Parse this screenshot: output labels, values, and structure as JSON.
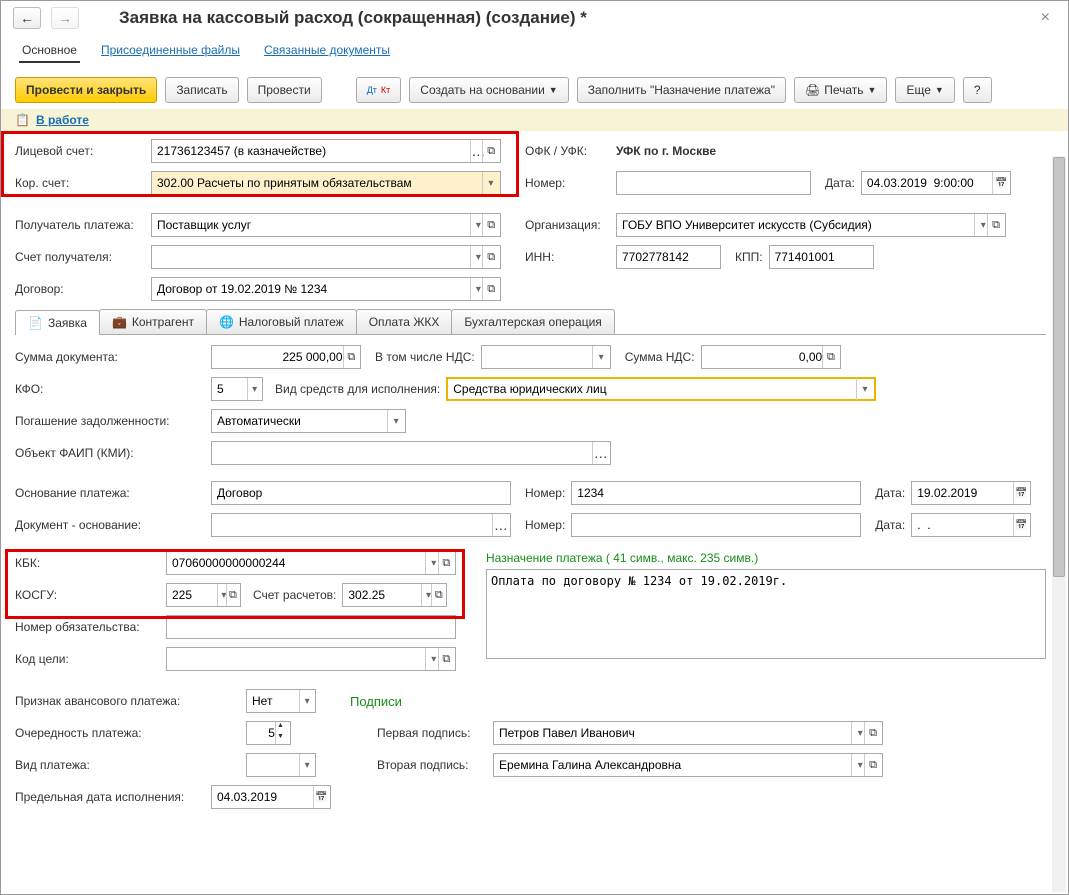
{
  "title": "Заявка на кассовый расход (сокращенная) (создание) *",
  "topTabs": {
    "main": "Основное",
    "files": "Присоединенные файлы",
    "docs": "Связанные документы"
  },
  "toolbar": {
    "save_close": "Провести и закрыть",
    "write": "Записать",
    "post": "Провести",
    "create_basis": "Создать на основании",
    "fill_purpose": "Заполнить \"Назначение платежа\"",
    "print": "Печать",
    "more": "Еще"
  },
  "status": "В работе",
  "labels": {
    "account": "Лицевой счет:",
    "corr": "Кор. счет:",
    "ofk": "ОФК / УФК:",
    "number": "Номер:",
    "date": "Дата:",
    "payee": "Получатель платежа:",
    "org": "Организация:",
    "payee_acc": "Счет получателя:",
    "inn": "ИНН:",
    "kpp": "КПП:",
    "contract": "Договор:",
    "doc_sum": "Сумма документа:",
    "incl_vat": "В том числе НДС:",
    "vat_sum": "Сумма НДС:",
    "kfo": "КФО:",
    "funds_type": "Вид средств для исполнения:",
    "debt": "Погашение задолженности:",
    "faip": "Объект ФАИП (КМИ):",
    "basis": "Основание платежа:",
    "basis_num": "Номер:",
    "basis_date": "Дата:",
    "basis_doc": "Документ - основание:",
    "basis_doc_num": "Номер:",
    "basis_doc_date": "Дата:",
    "kbk": "КБК:",
    "kosgu": "КОСГУ:",
    "calc_acc": "Счет расчетов:",
    "purpose_hdr": "Назначение платежа ( 41 симв., макс. 235 симв.)",
    "obligation": "Номер обязательства:",
    "target": "Код цели:",
    "advance": "Признак авансового платежа:",
    "signs": "Подписи",
    "priority": "Очередность платежа:",
    "sign1": "Первая подпись:",
    "pay_type": "Вид платежа:",
    "sign2": "Вторая подпись:",
    "deadline": "Предельная дата исполнения:"
  },
  "values": {
    "account": "21736123457 (в казначействе)",
    "corr": "302.00 Расчеты по принятым обязательствам",
    "ofk": "УФК по г. Москве",
    "number": "",
    "date": "04.03.2019  9:00:00",
    "payee": "Поставщик услуг",
    "org": "ГОБУ ВПО Университет искусств (Субсидия)",
    "payee_acc": "",
    "inn": "7702778142",
    "kpp": "771401001",
    "contract": "Договор от 19.02.2019 № 1234",
    "doc_sum": "225 000,00",
    "incl_vat": "",
    "vat_sum": "0,00",
    "kfo": "5",
    "funds_type": "Средства юридических лиц",
    "debt": "Автоматически",
    "faip": "",
    "basis": "Договор",
    "basis_num": "1234",
    "basis_date": "19.02.2019",
    "basis_doc": "",
    "basis_doc_num": "",
    "basis_doc_date": ".  .",
    "kbk": "07060000000000244",
    "kosgu": "225",
    "calc_acc": "302.25",
    "purpose": "Оплата по договору № 1234 от 19.02.2019г.",
    "obligation": "",
    "target": "",
    "advance": "Нет",
    "priority": "5",
    "sign1": "Петров Павел Иванович",
    "pay_type": "",
    "sign2": "Еремина Галина Александровна",
    "deadline": "04.03.2019"
  },
  "formTabs": {
    "app": "Заявка",
    "counter": "Контрагент",
    "tax": "Налоговый платеж",
    "housing": "Оплата ЖКХ",
    "accounting": "Бухгалтерская операция"
  }
}
